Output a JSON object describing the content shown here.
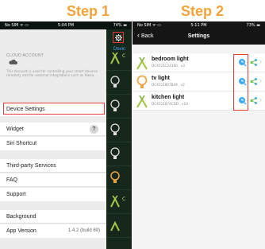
{
  "steps": {
    "step1": "Step 1",
    "step2": "Step 2"
  },
  "phone1": {
    "status": {
      "left": "No SIM ᯤ ▭",
      "time": "5:04 PM",
      "right": "74% ▬"
    },
    "background_list": {
      "header_label": "Devic",
      "rows": [
        {
          "title": "C",
          "sub": ""
        },
        {
          "title": "",
          "sub": ""
        },
        {
          "title": "",
          "sub": ""
        },
        {
          "title": "",
          "sub": ""
        },
        {
          "title": "",
          "sub": ""
        },
        {
          "title": "",
          "sub": ""
        },
        {
          "title": "C",
          "sub": ""
        },
        {
          "title": "",
          "sub": ""
        },
        {
          "title": "",
          "sub": ""
        }
      ]
    },
    "settings": {
      "cloud_header": "CLOUD ACCOUNT",
      "cloud_description": "This Account is used for controlling your smart devices remotely and for external integrations such as Alexa.",
      "device_settings": "Device Settings",
      "widget": "Widget",
      "widget_help": "?",
      "siri": "Siri Shortcut",
      "third_party": "Third-party Services",
      "faq": "FAQ",
      "support": "Support",
      "background": "Background",
      "app_version_label": "App Version",
      "app_version_value": "1.4.2 (build 69)"
    }
  },
  "phone2": {
    "status": {
      "left": "No SIM ᯤ ▭",
      "time": "5:11 PM",
      "right": "73% ▬"
    },
    "nav": {
      "back": "Back",
      "title": "Settings"
    },
    "devices": [
      {
        "name": "bedroom light",
        "meta": "DC4F22C24360 , v3",
        "icon": "bulb-plant-icon"
      },
      {
        "name": "tv light",
        "meta": "DC4F22807B49 , v2",
        "icon": "bulb-orange-icon"
      },
      {
        "name": "kitchen light",
        "meta": "DC4F2287ACDD , v10",
        "icon": "bulb-plant-icon"
      }
    ]
  },
  "colors": {
    "step": "#f2a23a",
    "highlight": "#e53a3a",
    "accent_blue": "#3fa9f5",
    "accent_green": "#5fbf3d"
  }
}
